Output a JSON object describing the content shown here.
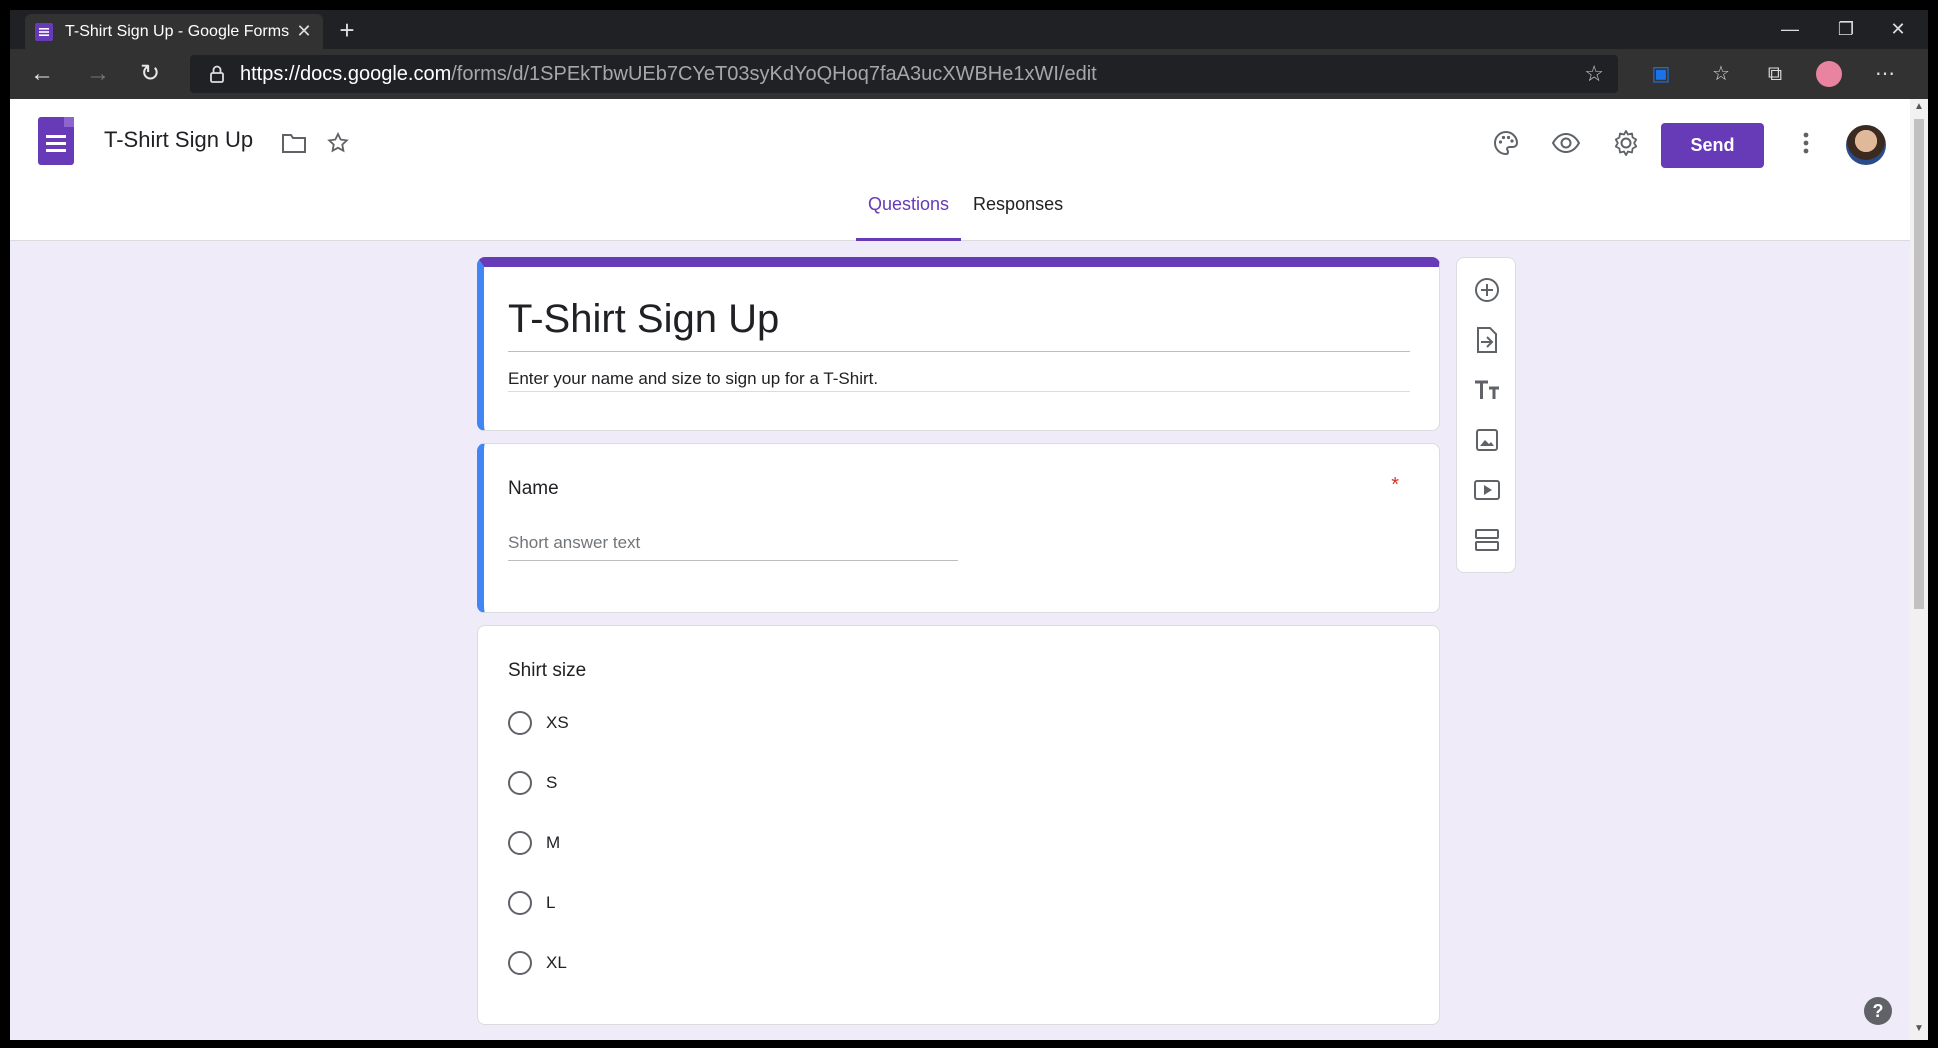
{
  "browser": {
    "tab_title": "T-Shirt Sign Up - Google Forms",
    "url_host": "https://docs.google.com",
    "url_path": "/forms/d/1SPEkTbwUEb7CYeT03syKdYoQHoq7faA3ucXWBHe1xWI/edit"
  },
  "header": {
    "doc_title": "T-Shirt Sign Up",
    "send_label": "Send"
  },
  "tabs": [
    {
      "label": "Questions",
      "active": true
    },
    {
      "label": "Responses",
      "active": false
    }
  ],
  "form": {
    "title": "T-Shirt Sign Up",
    "description": "Enter your name and size to sign up for a T-Shirt."
  },
  "questions": {
    "name": {
      "title": "Name",
      "required_mark": "*",
      "placeholder": "Short answer text"
    },
    "size": {
      "title": "Shirt size",
      "options": [
        "XS",
        "S",
        "M",
        "L",
        "XL"
      ]
    }
  },
  "help": {
    "label": "?"
  },
  "colors": {
    "accent": "#673ab7",
    "background": "#f0ebf8",
    "left_bar": "#4285f4"
  }
}
